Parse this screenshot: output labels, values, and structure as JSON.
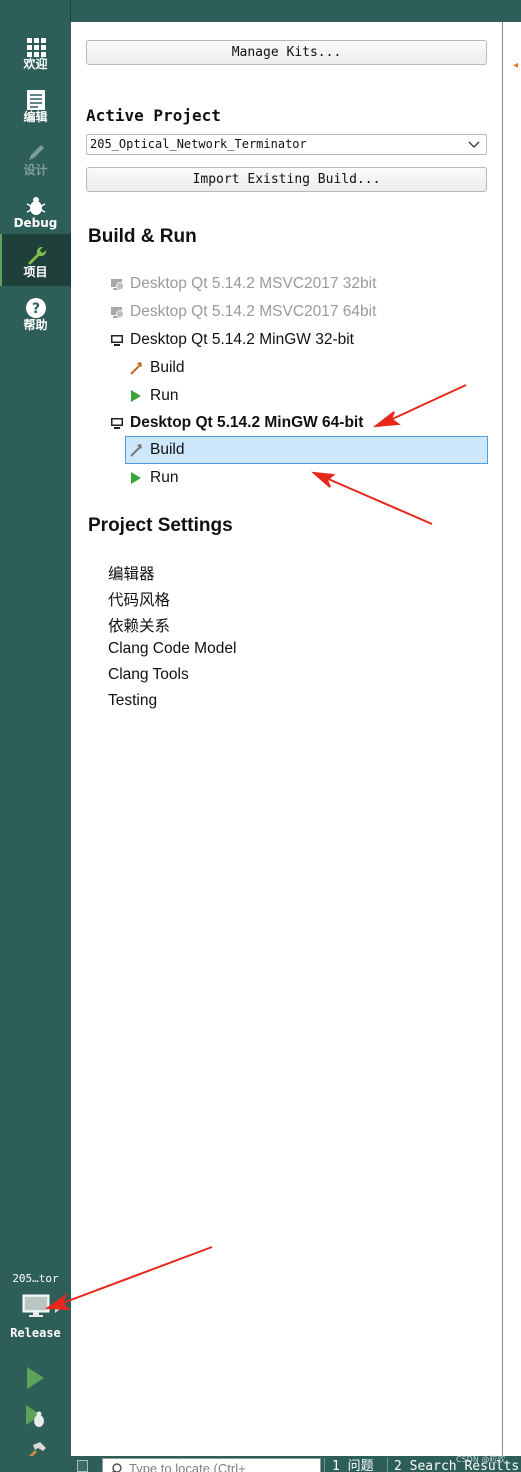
{
  "sidebar": {
    "modes": [
      {
        "label": "欢迎",
        "icon": "grid-icon"
      },
      {
        "label": "编辑",
        "icon": "document-icon"
      },
      {
        "label": "设计",
        "icon": "pencil-icon"
      },
      {
        "label": "Debug",
        "icon": "bug-icon"
      },
      {
        "label": "项目",
        "icon": "wrench-icon"
      },
      {
        "label": "帮助",
        "icon": "help-icon"
      }
    ],
    "target": {
      "project": "205…tor",
      "config": "Release"
    }
  },
  "panel": {
    "manage_kits": "Manage Kits...",
    "active_project_label": "Active Project",
    "active_project_value": "205_Optical_Network_Terminator",
    "import_build": "Import Existing Build...",
    "build_run_heading": "Build & Run",
    "kits": [
      {
        "name": "Desktop Qt 5.14.2 MSVC2017 32bit",
        "state": "disabled"
      },
      {
        "name": "Desktop Qt 5.14.2 MSVC2017 64bit",
        "state": "disabled"
      },
      {
        "name": "Desktop Qt 5.14.2 MinGW 32-bit",
        "state": "normal",
        "build": "Build",
        "run": "Run"
      },
      {
        "name": "Desktop Qt 5.14.2 MinGW 64-bit",
        "state": "active",
        "build": "Build",
        "run": "Run"
      }
    ],
    "project_settings_heading": "Project Settings",
    "settings": [
      "编辑器",
      "代码风格",
      "依赖关系",
      "Clang Code Model",
      "Clang Tools",
      "Testing"
    ]
  },
  "statusbar": {
    "search_placeholder": "Type to locate (Ctrl+",
    "panes": [
      "1 问题",
      "2 Search Results"
    ],
    "watermark": "CSDN @粒欢"
  },
  "colors": {
    "sidebar": "#2d5e57",
    "selection": "#cde8fb",
    "selection_border": "#4f9de0",
    "annotation_arrow": "#e8271c",
    "run_green": "#5ea35a"
  }
}
